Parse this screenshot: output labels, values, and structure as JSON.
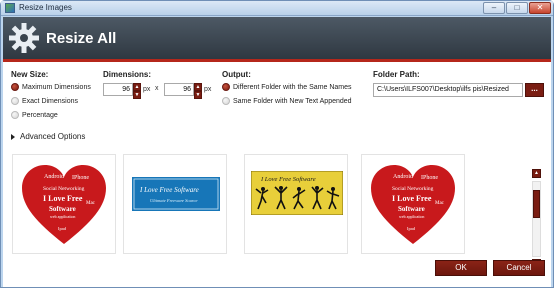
{
  "window": {
    "title": "Resize Images",
    "app_icon": "app-icon",
    "controls": {
      "minimize": "–",
      "maximize": "□",
      "close": "✕"
    }
  },
  "header": {
    "title": "Resize All",
    "icon": "gear-icon"
  },
  "new_size": {
    "heading": "New Size:",
    "options": [
      {
        "label": "Maximum Dimensions",
        "checked": true
      },
      {
        "label": "Exact Dimensions",
        "checked": false
      },
      {
        "label": "Percentage",
        "checked": false
      }
    ]
  },
  "dimensions": {
    "heading": "Dimensions:",
    "width": "96",
    "height": "96",
    "unit": "px",
    "separator": "x"
  },
  "output": {
    "heading": "Output:",
    "options": [
      {
        "label": "Different Folder with the Same Names",
        "checked": true
      },
      {
        "label": "Same Folder with New Text Appended",
        "checked": false
      }
    ]
  },
  "folder_path": {
    "heading": "Folder Path:",
    "value": "C:\\Users\\ILFS007\\Desktop\\ilfs pis\\Resized",
    "browse_label": "..."
  },
  "advanced": {
    "label": "Advanced Options"
  },
  "thumbnails": [
    {
      "name": "heart-love-free-software",
      "kind": "heart",
      "lines": [
        "Android",
        "IPhone",
        "Social Networking",
        "I Love Free",
        "Software",
        "web application",
        "Ipad",
        "Mac"
      ]
    },
    {
      "name": "i-love-free-software-blue",
      "kind": "blue",
      "lines": [
        "I Love Free Software",
        "Ultimate Freeware Source"
      ]
    },
    {
      "name": "i-love-free-software-dancers",
      "kind": "dancers",
      "lines": [
        "I Love Free Software"
      ]
    },
    {
      "name": "heart-love-free-software-2",
      "kind": "heart",
      "lines": [
        "Android",
        "IPhone",
        "Social Networking",
        "I Love Free",
        "Software",
        "web application",
        "Ipad",
        "Mac"
      ]
    }
  ],
  "footer": {
    "ok": "OK",
    "cancel": "Cancel"
  },
  "colors": {
    "accent": "#7a1d12",
    "header": "#3a444e",
    "stripe": "#b5271b"
  }
}
